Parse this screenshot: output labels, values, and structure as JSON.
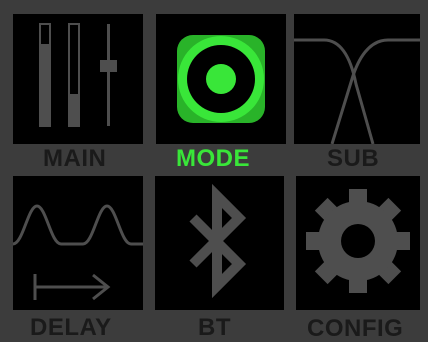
{
  "colors": {
    "background": "#3c3c3c",
    "tile": "#000000",
    "icon": "#4e4e4e",
    "label": "#1a1a1a",
    "active": "#39e639"
  },
  "menu": {
    "selected": "MODE",
    "items": [
      {
        "label": "MAIN",
        "icon": "faders-icon",
        "active": false
      },
      {
        "label": "MODE",
        "icon": "mode-record-icon",
        "active": true
      },
      {
        "label": "SUB",
        "icon": "crossover-filter-icon",
        "active": false
      },
      {
        "label": "DELAY",
        "icon": "delay-wave-icon",
        "active": false
      },
      {
        "label": "BT",
        "icon": "bluetooth-icon",
        "active": false
      },
      {
        "label": "CONFIG",
        "icon": "gear-icon",
        "active": false
      }
    ]
  }
}
